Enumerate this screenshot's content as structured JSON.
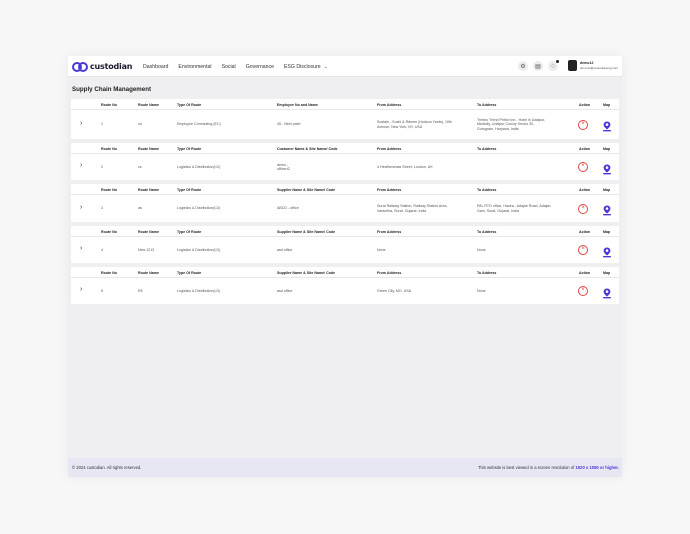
{
  "brand": {
    "name": "custodian",
    "accent": "#4b39d6"
  },
  "nav": [
    {
      "label": "Dashboard"
    },
    {
      "label": "Environmental"
    },
    {
      "label": "Social"
    },
    {
      "label": "Governance"
    },
    {
      "label": "ESG Disclosure"
    }
  ],
  "user": {
    "name": "demo12",
    "email": "demo12@custodianesg.com"
  },
  "page_title": "Supply Chain Management",
  "routes": [
    {
      "headers": [
        "Route No",
        "Route Name",
        "Type Of Route",
        "Employee No and Name",
        "From Address",
        "To Address",
        "Action",
        "Map"
      ],
      "route_no": "1",
      "route_name": "cd",
      "route_type": "Employee Commuting (EC)",
      "party": [
        "45 - Neel patel"
      ],
      "from": [
        "Sustain - Sushi & Ramen (Hudson Yards), 10th",
        "Avenue, New York, NY, USA"
      ],
      "to": [
        "Treebo Trend Prithvi Inn - Hotel in Udaipur,",
        "Medicity, Udaipur Colony Sector 30,",
        "Gurugram, Haryana, India"
      ]
    },
    {
      "headers": [
        "Route No",
        "Route Name",
        "Type Of Route",
        "Customer Name & Site Name/ Code",
        "From Address",
        "To Address",
        "Action",
        "Map"
      ],
      "route_no": "2",
      "route_name": "cs",
      "route_type": "Logistics & Distribution(LD)",
      "party": [
        "demo -",
        "officert2"
      ],
      "from": [
        "4 Heathershaw Street, London, UK"
      ],
      "to": []
    },
    {
      "headers": [
        "Route No",
        "Route Name",
        "Type Of Route",
        "Supplier Name & Site Name/ Code",
        "From Address",
        "To Address",
        "Action",
        "Map"
      ],
      "route_no": "3",
      "route_name": "as",
      "route_type": "Logistics & Distribution(LD)",
      "party": [
        "ABCD - office"
      ],
      "from": [
        "Surat Railway Station, Railway Station Area,",
        "Varachha, Surat, Gujarat, India"
      ],
      "to": [
        "PAL RTO office, Hazira - Adajan Road, Adajan",
        "Gam, Surat, Gujarat, India"
      ]
    },
    {
      "headers": [
        "Route No",
        "Route Name",
        "Type Of Route",
        "Supplier Name & Site Name/ Code",
        "From Address",
        "To Address",
        "Action",
        "Map"
      ],
      "route_no": "4",
      "route_name": "New 1213",
      "route_type": "Logistics & Distribution(LD)",
      "party": [
        "asd office"
      ],
      "from": [
        "None"
      ],
      "to": [
        "None"
      ]
    },
    {
      "headers": [
        "Route No",
        "Route Name",
        "Type Of Route",
        "Supplier Name & Site Name/ Code",
        "From Address",
        "To Address",
        "Action",
        "Map"
      ],
      "route_no": "5",
      "route_name": "R5",
      "route_type": "Logistics & Distribution(LD)",
      "party": [
        "asd office"
      ],
      "from": [
        "Green City, MO, USA"
      ],
      "to": [
        "None"
      ]
    }
  ],
  "footer": {
    "copyright": "© 2024 custodian. All rights reserved.",
    "notice_prefix": "This website is best viewed in a screen resolution of ",
    "notice_res": "1920 x 1080 or higher."
  },
  "colors": {
    "delete": "#e04646",
    "map": "#4b39d6",
    "footer_bg": "#e7e6f3"
  },
  "icons": {
    "expand": "chevron-right-icon",
    "delete": "close-circle-icon",
    "map": "map-pin-icon",
    "dropdown": "chevron-down-icon",
    "notifications": "bell-icon",
    "settings": "gear-icon",
    "messages": "chat-icon"
  }
}
